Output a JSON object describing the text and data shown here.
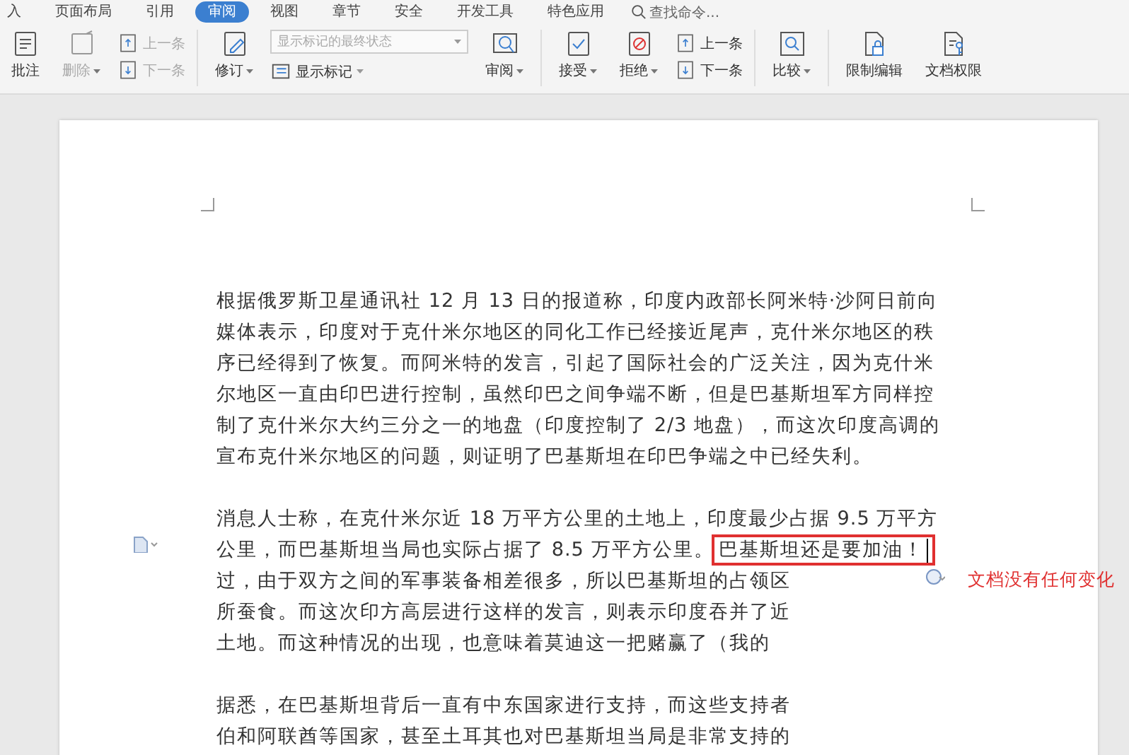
{
  "tabs": [
    {
      "label": "入",
      "selected": false
    },
    {
      "label": "页面布局",
      "selected": false
    },
    {
      "label": "引用",
      "selected": false
    },
    {
      "label": "审阅",
      "selected": true
    },
    {
      "label": "视图",
      "selected": false
    },
    {
      "label": "章节",
      "selected": false
    },
    {
      "label": "安全",
      "selected": false
    },
    {
      "label": "开发工具",
      "selected": false
    },
    {
      "label": "特色应用",
      "selected": false
    }
  ],
  "search": {
    "placeholder": "查找命令..."
  },
  "ribbon": [
    {
      "kind": "large",
      "label": "批注",
      "disabled": false
    },
    {
      "kind": "large",
      "label": "删除",
      "dropdown": true,
      "disabled": true
    },
    {
      "kind": "pair",
      "items": [
        {
          "label": "上一条",
          "disabled": true
        },
        {
          "label": "下一条",
          "disabled": true
        }
      ]
    },
    {
      "kind": "separator"
    },
    {
      "kind": "large",
      "label": "修订",
      "dropdown": true,
      "disabled": false
    },
    {
      "kind": "combo",
      "value": "显示标记的最终状态",
      "label": "显示标记",
      "disabled": true
    },
    {
      "kind": "large",
      "label": "审阅",
      "dropdown": true,
      "disabled": false
    },
    {
      "kind": "separator"
    },
    {
      "kind": "large",
      "label": "接受",
      "dropdown": true,
      "disabled": false
    },
    {
      "kind": "large",
      "label": "拒绝",
      "dropdown": true,
      "disabled": false
    },
    {
      "kind": "pair",
      "items": [
        {
          "label": "上一条",
          "disabled": false
        },
        {
          "label": "下一条",
          "disabled": false
        }
      ]
    },
    {
      "kind": "separator"
    },
    {
      "kind": "large",
      "label": "比较",
      "dropdown": true,
      "disabled": false
    },
    {
      "kind": "separator"
    },
    {
      "kind": "large",
      "label": "限制编辑",
      "disabled": false
    },
    {
      "kind": "large",
      "label": "文档权限",
      "disabled": false
    }
  ],
  "document": {
    "paragraphs": [
      {
        "lines": [
          {
            "text": "根据俄罗斯卫星通讯社 12 月 13 日的报道称，印度内政部长阿米特·沙阿日前向"
          },
          {
            "text": "媒体表示，印度对于克什米尔地区的同化工作已经接近尾声，克什米尔地区的秩"
          },
          {
            "text": "序已经得到了恢复。而阿米特的发言，引起了国际社会的广泛关注，因为克什米"
          },
          {
            "text": "尔地区一直由印巴进行控制，虽然印巴之间争端不断，但是巴基斯坦军方同样控"
          },
          {
            "text": "制了克什米尔大约三分之一的地盘（印度控制了 2/3 地盘），而这次印度高调的"
          },
          {
            "text": "宣布克什米尔地区的问题，则证明了巴基斯坦在印巴争端之中已经失利。"
          }
        ]
      },
      {
        "lines": [
          {
            "text": "消息人士称，在克什米尔近 18 万平方公里的土地上，印度最少占据 9.5 万平方"
          },
          {
            "text": "公里，而巴基斯坦当局也实际占据了 8.5 万平方公里。",
            "inserted": "巴基斯坦还是要加油！"
          },
          {
            "text": "过，由于双方之间的军事装备相差很多，所以巴基斯坦的占领区"
          },
          {
            "text": "所蚕食。而这次印方高层进行这样的发言，则表示印度吞并了近"
          },
          {
            "text": "土地。而这种情况的出现，也意味着莫迪这一把赌赢了（我的"
          }
        ]
      },
      {
        "lines": [
          {
            "text": "据悉，在巴基斯坦背后一直有中东国家进行支持，而这些支持者"
          },
          {
            "text": "伯和阿联酋等国家，甚至土耳其也对巴基斯坦当局是非常支持的"
          }
        ]
      }
    ],
    "comment": {
      "text": "文档没有任何变化"
    }
  }
}
